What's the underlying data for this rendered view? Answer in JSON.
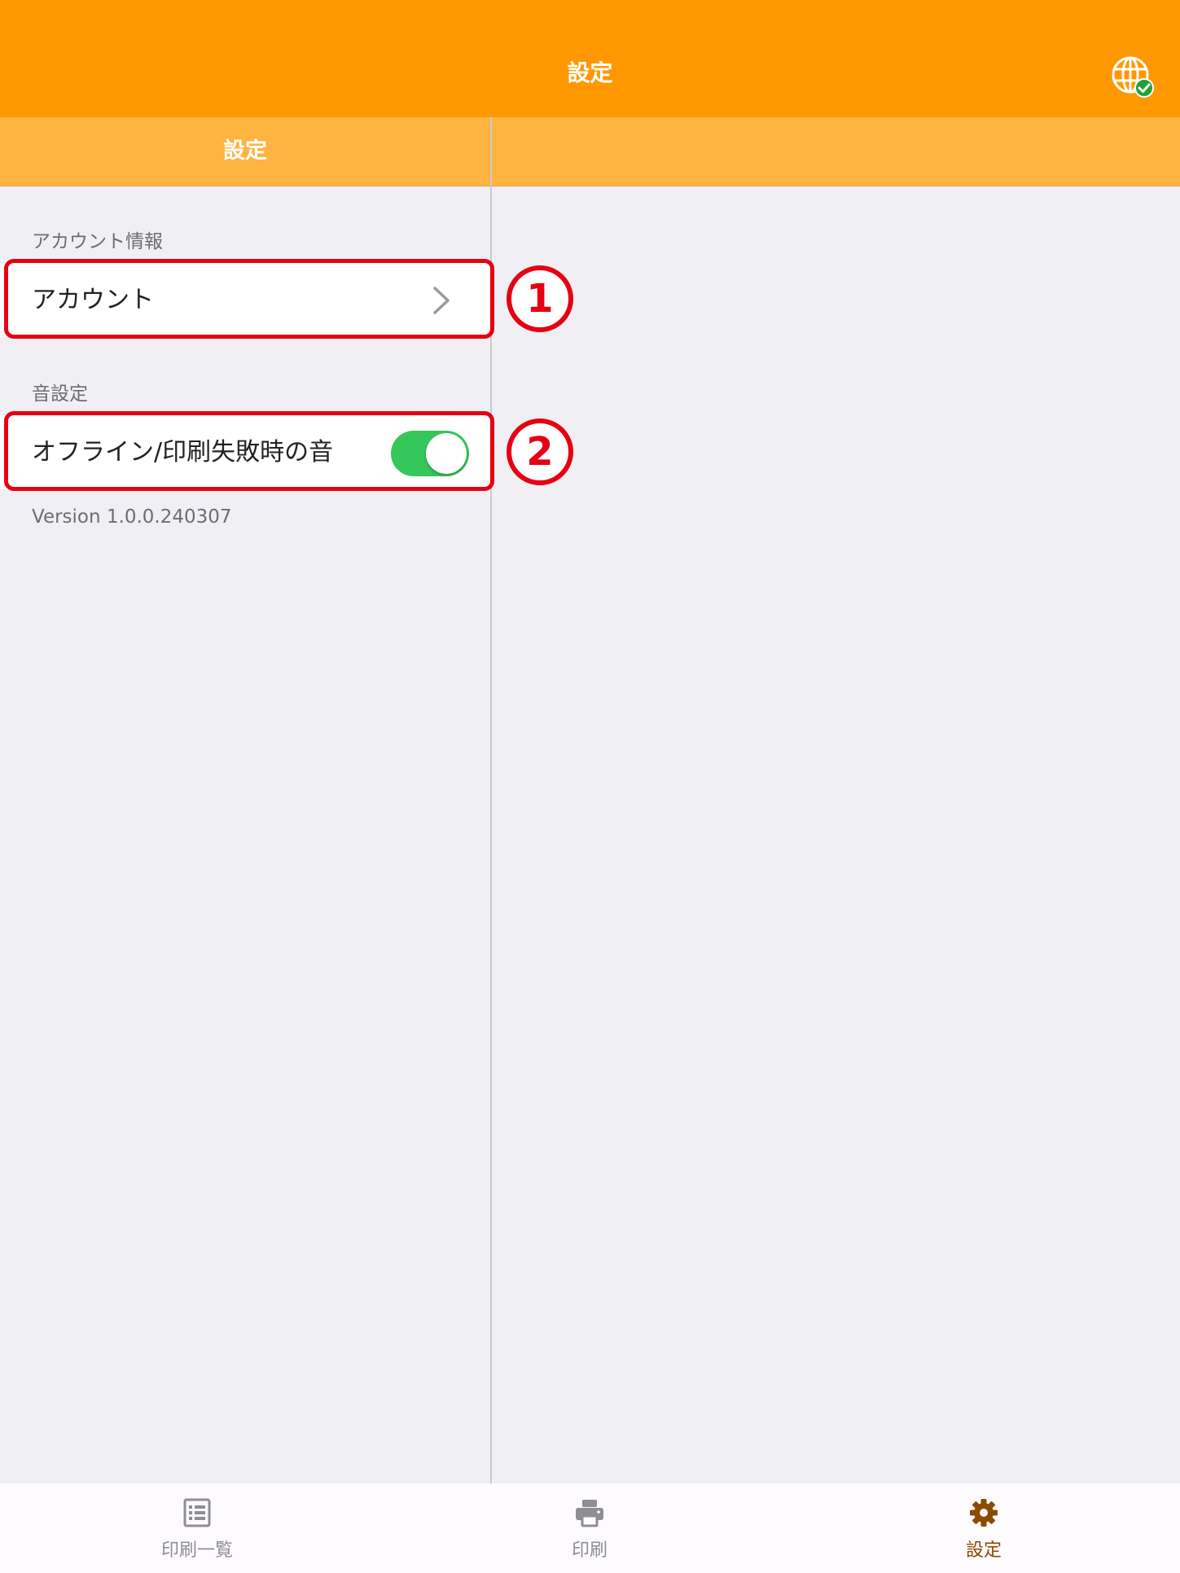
{
  "header": {
    "title": "設定",
    "status_icon": "globe-check-icon"
  },
  "subheader": {
    "title": "設定"
  },
  "sections": [
    {
      "label": "アカウント情報",
      "items": [
        {
          "label": "アカウント",
          "accessory": "chevron-right-icon",
          "marker": "①"
        }
      ]
    },
    {
      "label": "音設定",
      "items": [
        {
          "label": "オフライン/印刷失敗時の音",
          "accessory": "toggle",
          "value": true,
          "marker": "②"
        }
      ]
    }
  ],
  "version": "Version 1.0.0.240307",
  "tabs": [
    {
      "label": "印刷一覧",
      "icon": "list-icon",
      "active": false
    },
    {
      "label": "印刷",
      "icon": "printer-icon",
      "active": false
    },
    {
      "label": "設定",
      "icon": "gear-icon",
      "active": true
    }
  ],
  "colors": {
    "header": "#ff9800",
    "subheader": "#ffb340",
    "toggle_on": "#34c759",
    "highlight": "#e60012",
    "active_tab": "#8b4a00"
  }
}
